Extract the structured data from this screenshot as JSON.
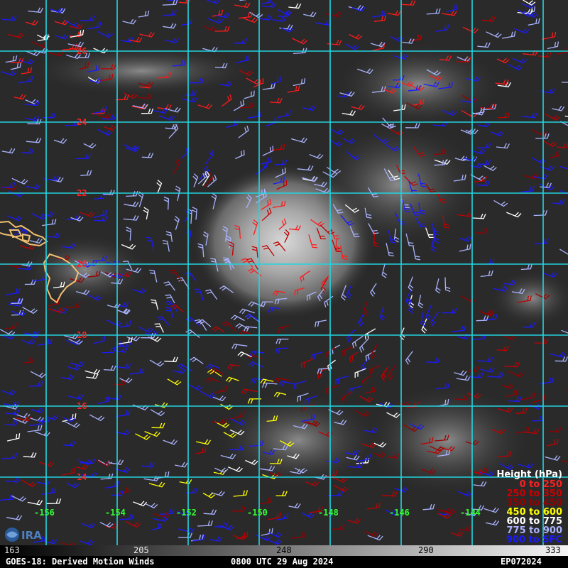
{
  "map": {
    "latitudes": [
      "26",
      "24",
      "22",
      "20",
      "18",
      "16",
      "14"
    ],
    "longitudes": [
      "-156",
      "-154",
      "-152",
      "-150",
      "-148",
      "-146",
      "-144"
    ],
    "grid_color": "#22d4e0",
    "coast_color": "#f0c070",
    "wind_barb_colors": {
      "0_250": "#ff1a1a",
      "250_350": "#c00000",
      "350_450": "#990000",
      "450_600": "#ffff00",
      "600_775": "#ffffff",
      "775_900": "#aab4ff",
      "900_sfc": "#1a1aff"
    }
  },
  "legend": {
    "title": "Height (hPa)",
    "items": [
      {
        "label": "0 to 250",
        "color": "#ff2020"
      },
      {
        "label": "250 to 350",
        "color": "#cc0000"
      },
      {
        "label": "350 to 450",
        "color": "#990000"
      },
      {
        "label": "450 to 600",
        "color": "#ffff00"
      },
      {
        "label": "600 to 775",
        "color": "#ffffff"
      },
      {
        "label": "775 to 900",
        "color": "#aab4ff"
      },
      {
        "label": "900 to SFC",
        "color": "#1a1aff"
      }
    ]
  },
  "colorbar": {
    "ticks": [
      "163",
      "205",
      "248",
      "290",
      "333"
    ]
  },
  "footer": {
    "left": "GOES-18: Derived Motion Winds",
    "center": "0800 UTC 29 Aug 2024",
    "right": "EP072024"
  },
  "logo": {
    "icon": "cira-logo"
  }
}
